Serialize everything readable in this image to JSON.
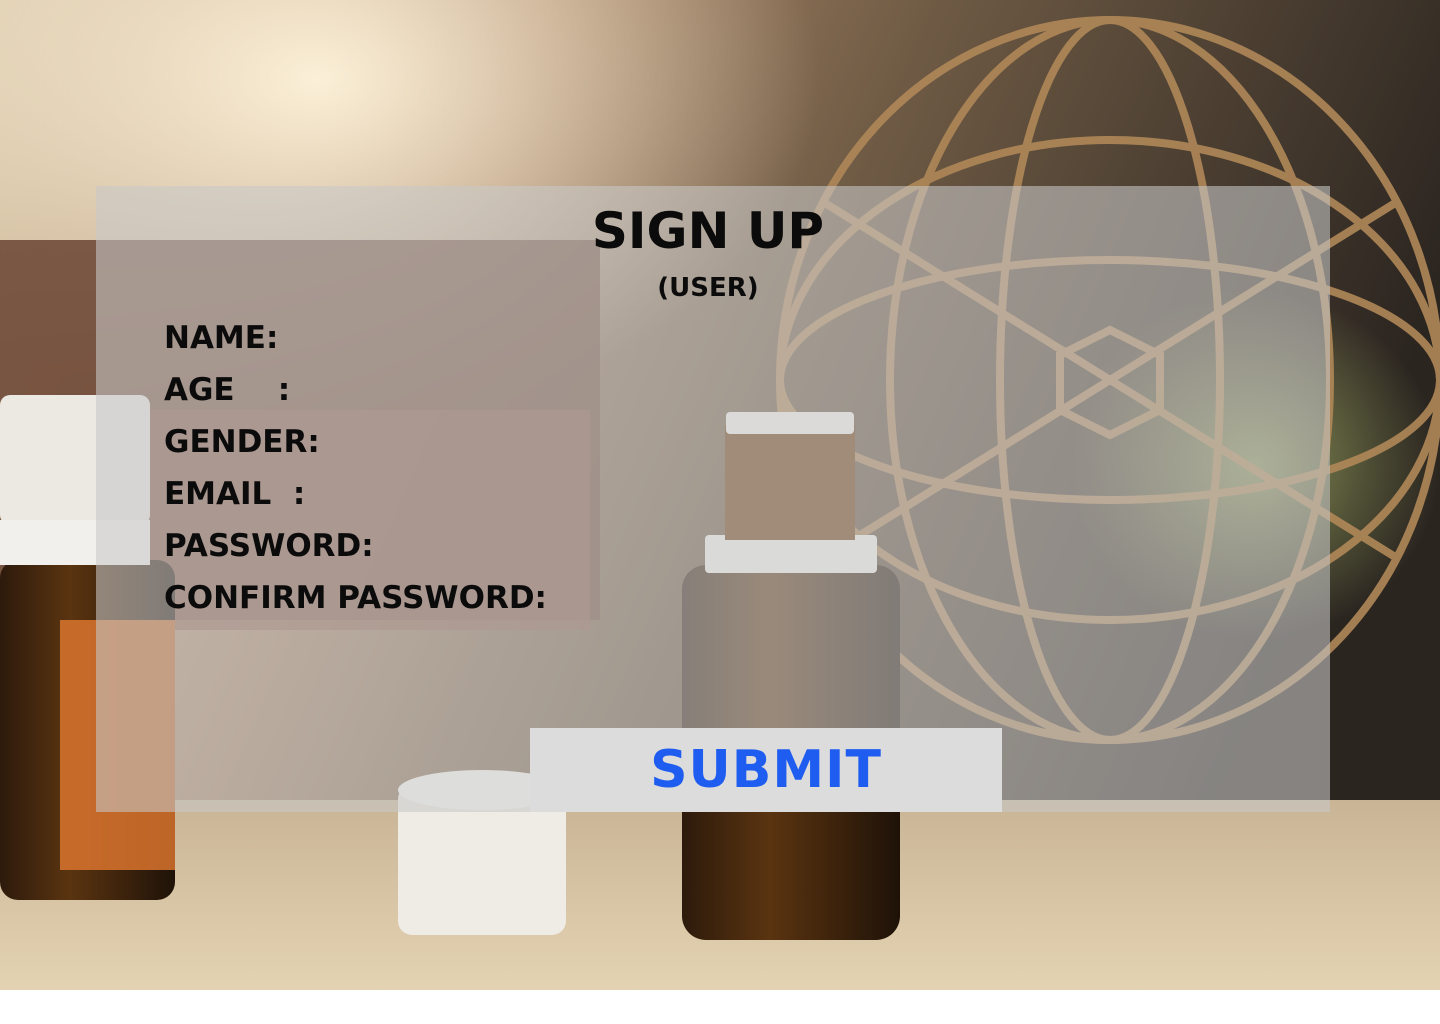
{
  "heading": {
    "title": "SIGN UP",
    "subtitle": "(USER)"
  },
  "form": {
    "fields": [
      {
        "label": "NAME:"
      },
      {
        "label": "AGE    :"
      },
      {
        "label": "GENDER:"
      },
      {
        "label": "EMAIL  :"
      },
      {
        "label": "PASSWORD:"
      },
      {
        "label": "CONFIRM PASSWORD:"
      }
    ],
    "submit_label": "SUBMIT"
  },
  "colors": {
    "submit_text": "#1f5cf0",
    "submit_bg": "#dcdcdc",
    "label_text": "#0b0b0b"
  }
}
